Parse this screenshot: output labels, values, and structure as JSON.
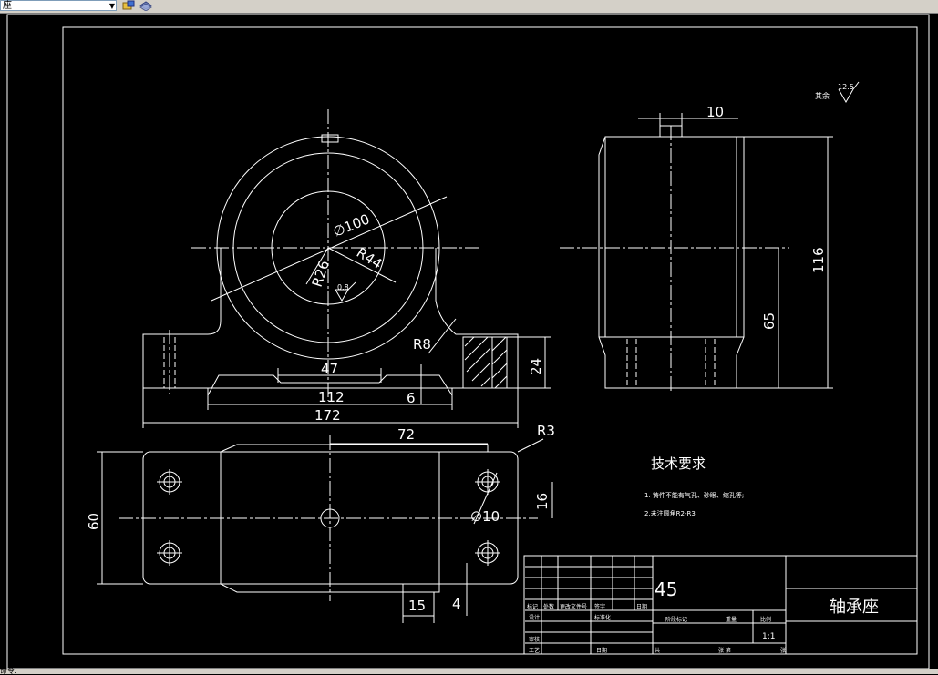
{
  "toolbar": {
    "layer_value": "座"
  },
  "title_block": {
    "material": "45",
    "part_name": "轴承座",
    "scale_value": "1:1",
    "row_labels": [
      "标记",
      "处数",
      "更改文件号",
      "签字",
      "日期"
    ],
    "left_labels": [
      "设计",
      "审核",
      "工艺"
    ],
    "standard_label": "标准化",
    "stage_labels": [
      "阶段标记",
      "重量",
      "比例"
    ],
    "sheet_total": "共",
    "sheet_of": "张 第",
    "sheet_end": "张",
    "date_label": "日期"
  },
  "notes": {
    "heading": "技术要求",
    "items": [
      "1. 铸件不能有气孔、砂眼、缩孔等;",
      "2.未注圆角R2-R3"
    ]
  },
  "roughness": {
    "other_label": "其余",
    "value": "12.5",
    "bore_value": "0.8"
  },
  "dimensions": {
    "front_dia": "∅100",
    "front_r44": "R44",
    "front_r26": "R26",
    "front_r8": "R8",
    "front_47": "47",
    "front_112": "112",
    "front_172": "172",
    "front_6": "6",
    "front_24": "24",
    "side_10": "10",
    "side_116": "116",
    "side_65": "65",
    "top_72": "72",
    "top_r3": "R3",
    "top_16": "16",
    "top_dia10": "∅10",
    "top_60": "60",
    "top_15": "15",
    "top_4": "4"
  },
  "statusbar": {
    "text": "命令:"
  }
}
